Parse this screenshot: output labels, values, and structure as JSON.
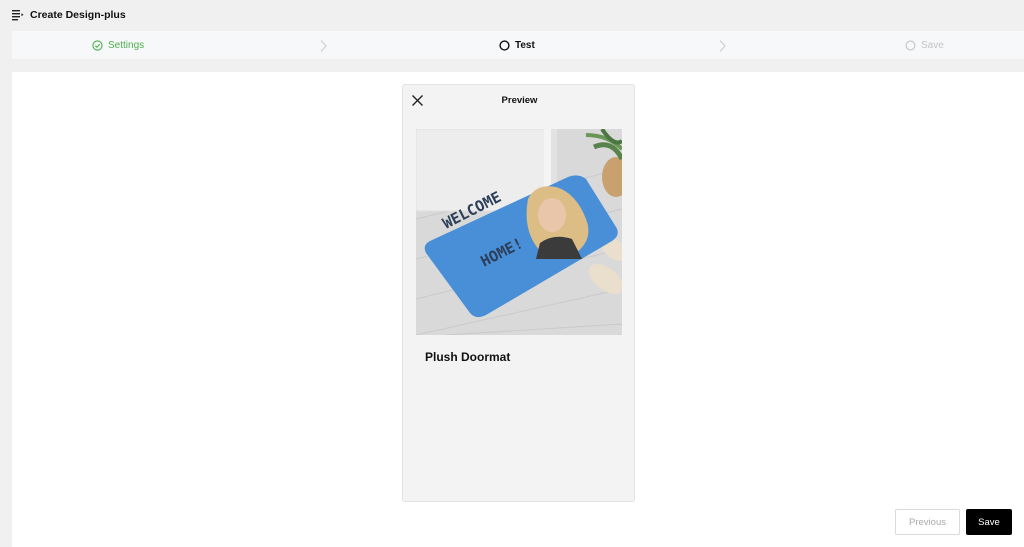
{
  "app": {
    "title": "Create Design-plus"
  },
  "steps": [
    {
      "label": "Settings",
      "state": "completed"
    },
    {
      "label": "Test",
      "state": "active"
    },
    {
      "label": "Save",
      "state": "pending"
    }
  ],
  "preview": {
    "title": "Preview",
    "product_name": "Plush Doormat",
    "mat_text_line1": "WELCOME",
    "mat_text_line2": "HOME!"
  },
  "buttons": {
    "previous": "Previous",
    "save": "Save"
  },
  "colors": {
    "completed": "#4caf50",
    "pending": "#c4c4c4",
    "mat": "#3a86d4",
    "primary_button": "#000000"
  }
}
